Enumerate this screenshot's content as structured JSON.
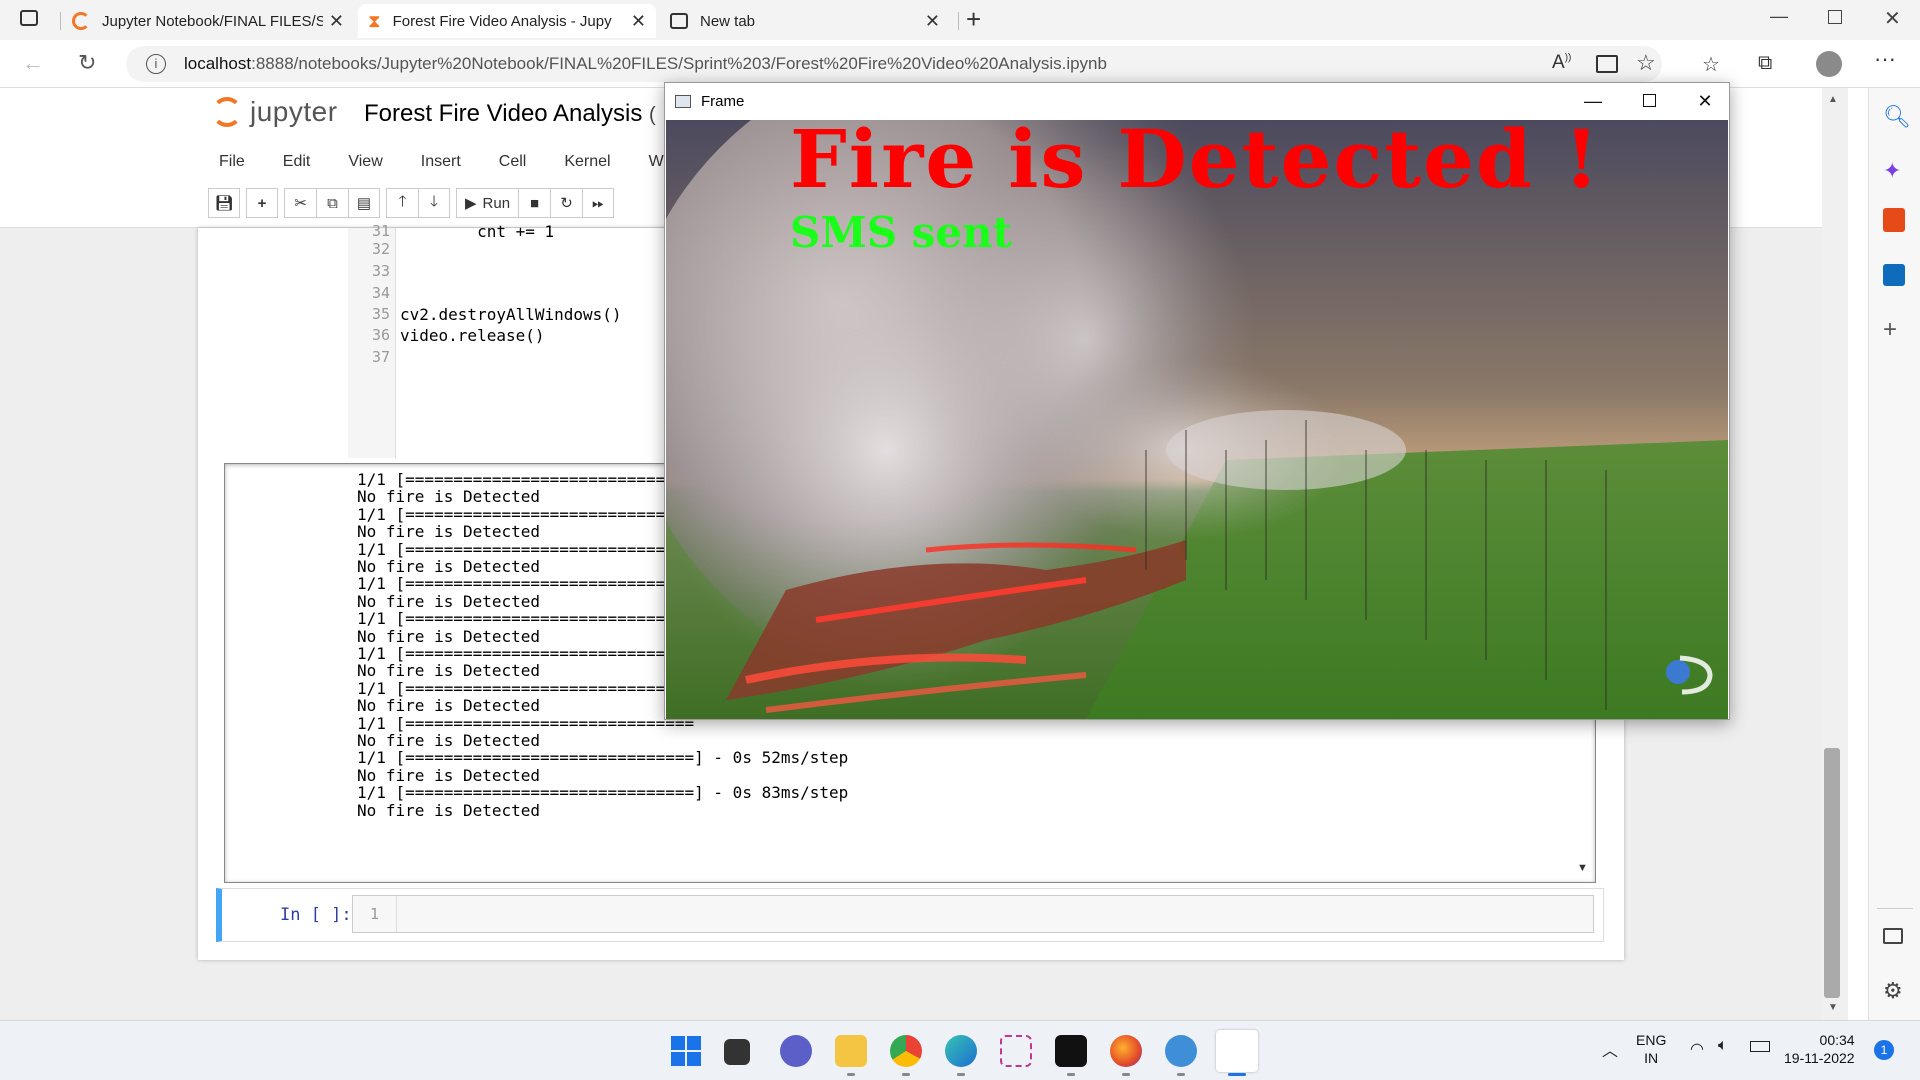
{
  "browser": {
    "tabs": [
      {
        "label": "Jupyter Notebook/FINAL FILES/S",
        "active": false
      },
      {
        "label": "Forest Fire Video Analysis - Jupy",
        "active": true
      },
      {
        "label": "New tab",
        "active": false
      }
    ],
    "new_tab_glyph": "+",
    "url_host": "localhost",
    "url_rest": ":8888/notebooks/Jupyter%20Notebook/FINAL%20FILES/Sprint%203/Forest%20Fire%20Video%20Analysis.ipynb"
  },
  "jupyter": {
    "logo_text": "jupyter",
    "notebook_title": "Forest Fire Video Analysis",
    "title_suffix": "(",
    "menu": [
      "File",
      "Edit",
      "View",
      "Insert",
      "Cell",
      "Kernel",
      "W"
    ],
    "run_label": "Run",
    "code_lines": [
      {
        "n": "31",
        "code": "        cnt += 1"
      },
      {
        "n": "32",
        "code": ""
      },
      {
        "n": "33",
        "code": ""
      },
      {
        "n": "34",
        "code": ""
      },
      {
        "n": "35",
        "code": "cv2.destroyAllWindows()"
      },
      {
        "n": "36",
        "code": "video.release()"
      },
      {
        "n": "37",
        "code": ""
      }
    ],
    "output_lines": [
      "1/1 [==============================",
      "No fire is Detected",
      "1/1 [==============================",
      "No fire is Detected",
      "1/1 [==============================",
      "No fire is Detected",
      "1/1 [==============================",
      "No fire is Detected",
      "1/1 [==============================",
      "No fire is Detected",
      "1/1 [==============================",
      "No fire is Detected",
      "1/1 [==============================",
      "No fire is Detected",
      "1/1 [==============================",
      "No fire is Detected",
      "1/1 [==============================] - 0s 52ms/step",
      "No fire is Detected",
      "1/1 [==============================] - 0s 83ms/step",
      "No fire is Detected"
    ],
    "in_prompt": "In [ ]:",
    "in_line_number": "1"
  },
  "frame": {
    "title": "Frame",
    "overlay_alert": "Fire is Detected !",
    "overlay_status": "SMS sent",
    "alert_color": "#ff0000",
    "status_color": "#19ff19"
  },
  "taskbar": {
    "lang": "ENG",
    "region": "IN",
    "time": "00:34",
    "date": "19-11-2022",
    "notification_count": "1"
  }
}
